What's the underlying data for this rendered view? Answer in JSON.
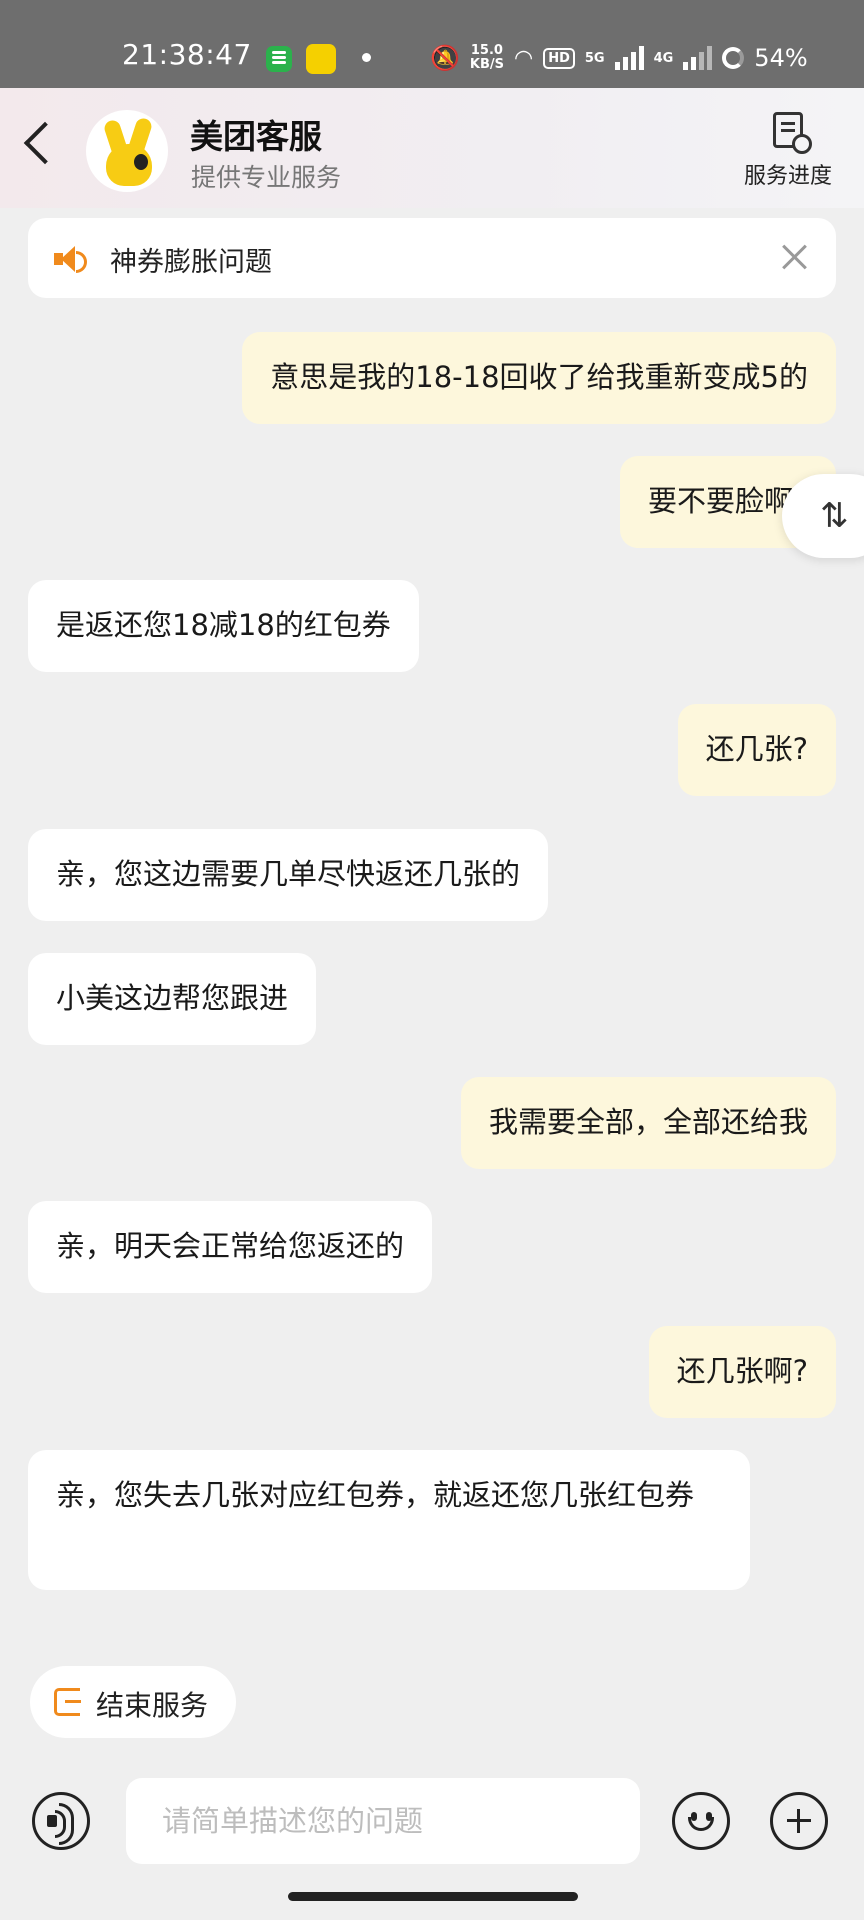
{
  "status_bar": {
    "time": "21:38:47",
    "net_speed": "15.0",
    "net_unit": "KB/S",
    "hd": "HD",
    "net_5g": "5G",
    "net_4g": "4G",
    "battery": "54%",
    "icons": [
      "messaging-app-icon",
      "notes-app-icon",
      "dot-icon",
      "mute-icon",
      "wifi-icon",
      "signal-icon",
      "battery-icon"
    ]
  },
  "header": {
    "title": "美团客服",
    "subtitle": "提供专业服务",
    "progress_label": "服务进度"
  },
  "notice": {
    "text": "神券膨胀问题"
  },
  "messages": [
    {
      "from": "user",
      "text": "意思是我的18-18回收了给我重新变成5的"
    },
    {
      "from": "user",
      "text": "要不要脸啊"
    },
    {
      "from": "bot",
      "text": "是返还您18减18的红包券"
    },
    {
      "from": "user",
      "text": "还几张?"
    },
    {
      "from": "bot",
      "text": "亲，您这边需要几单尽快返还几张的"
    },
    {
      "from": "bot",
      "text": "小美这边帮您跟进"
    },
    {
      "from": "user",
      "text": "我需要全部，全部还给我"
    },
    {
      "from": "bot",
      "text": "亲，明天会正常给您返还的"
    },
    {
      "from": "user",
      "text": "还几张啊?"
    },
    {
      "from": "bot",
      "text": "亲，您失去几张对应红包券，就返还您几张红包券"
    }
  ],
  "sort_fab": {
    "glyph": "⇅"
  },
  "end_service": {
    "label": "结束服务"
  },
  "composer": {
    "placeholder": "请简单描述您的问题"
  },
  "colors": {
    "user_bubble": "#fdf7dc",
    "bot_bubble": "#ffffff",
    "accent": "#f08a1c",
    "background": "#efefef"
  }
}
